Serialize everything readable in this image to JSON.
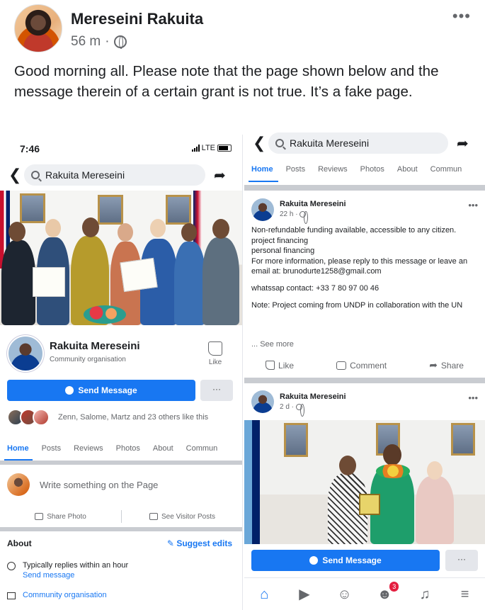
{
  "post": {
    "author": "Mereseini Rakuita",
    "time": "56 m",
    "dot": "·",
    "more": "•••",
    "text": "Good morning all. Please note that the page shown below and the message therein of a certain grant is not true. It’s a fake page."
  },
  "left_screenshot": {
    "status_time": "7:46",
    "network": "LTE",
    "search_text": "Rakuita Mereseini",
    "back_glyph": "❮",
    "share_glyph": "➦",
    "page_name": "Rakuita Mereseini",
    "page_category": "Community organisation",
    "like_label": "Like",
    "send_message": "Send Message",
    "more_label": "···",
    "likers_text": "Zenn, Salome, Martz and 23 others like this",
    "tabs": [
      "Home",
      "Posts",
      "Reviews",
      "Photos",
      "About",
      "Commun"
    ],
    "write_placeholder": "Write something on the Page",
    "share_photo": "Share Photo",
    "see_visitor_posts": "See Visitor Posts",
    "about_title": "About",
    "suggest_edits": "Suggest edits",
    "replies_text": "Typically replies within an hour",
    "send_message_link": "Send message",
    "category_row": "Community organisation"
  },
  "right_screenshot": {
    "search_text": "Rakuita Mereseini",
    "back_glyph": "❮",
    "share_glyph": "➦",
    "tabs": [
      "Home",
      "Posts",
      "Reviews",
      "Photos",
      "About",
      "Commun"
    ],
    "post1": {
      "name": "Rakuita Mereseini",
      "time": "22 h ·",
      "more": "•••",
      "line1": "Non-refundable funding available, accessible to any citizen.",
      "line2": "project financing",
      "line3": "personal financing",
      "line4": "For more information, please reply to this message or leave an email at: brunodurte1258@gmail.com",
      "line5": "whatssap contact: +33 7 80 97 00 46",
      "line6": "Note: Project coming from UNDP in collaboration with the UN",
      "see_more": "... See more",
      "like": "Like",
      "comment": "Comment",
      "share": "Share"
    },
    "post2": {
      "name": "Rakuita Mereseini",
      "time": "2 d ·",
      "more": "•••"
    },
    "send_message": "Send Message",
    "more_label": "···",
    "notification_count": "3"
  },
  "colors": {
    "brand_blue": "#1877f2",
    "text_primary": "#1c1e21",
    "text_secondary": "#65676b",
    "badge_red": "#e41e3f"
  }
}
